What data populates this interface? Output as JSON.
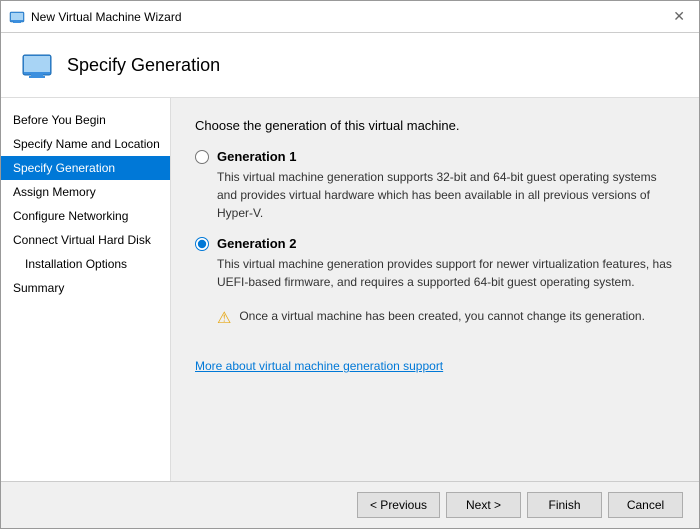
{
  "window": {
    "title": "New Virtual Machine Wizard",
    "close_label": "✕"
  },
  "header": {
    "title": "Specify Generation"
  },
  "sidebar": {
    "items": [
      {
        "id": "before-you-begin",
        "label": "Before You Begin",
        "active": false,
        "sub": false
      },
      {
        "id": "specify-name",
        "label": "Specify Name and Location",
        "active": false,
        "sub": false
      },
      {
        "id": "specify-generation",
        "label": "Specify Generation",
        "active": true,
        "sub": false
      },
      {
        "id": "assign-memory",
        "label": "Assign Memory",
        "active": false,
        "sub": false
      },
      {
        "id": "configure-networking",
        "label": "Configure Networking",
        "active": false,
        "sub": false
      },
      {
        "id": "connect-vhd",
        "label": "Connect Virtual Hard Disk",
        "active": false,
        "sub": false
      },
      {
        "id": "installation-options",
        "label": "Installation Options",
        "active": false,
        "sub": true
      },
      {
        "id": "summary",
        "label": "Summary",
        "active": false,
        "sub": false
      }
    ]
  },
  "content": {
    "intro": "Choose the generation of this virtual machine.",
    "generation1": {
      "label": "Generation 1",
      "description": "This virtual machine generation supports 32-bit and 64-bit guest operating systems and provides virtual hardware which has been available in all previous versions of Hyper-V."
    },
    "generation2": {
      "label": "Generation 2",
      "description": "This virtual machine generation provides support for newer virtualization features, has UEFI-based firmware, and requires a supported 64-bit guest operating system."
    },
    "warning": "Once a virtual machine has been created, you cannot change its generation.",
    "link": "More about virtual machine generation support"
  },
  "footer": {
    "previous_label": "< Previous",
    "next_label": "Next >",
    "finish_label": "Finish",
    "cancel_label": "Cancel"
  }
}
